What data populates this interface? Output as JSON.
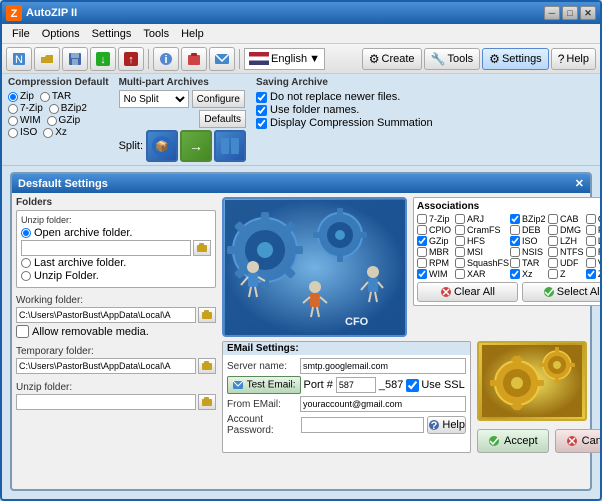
{
  "app": {
    "title": "AutoZIP II",
    "icon": "zip"
  },
  "titlebar": {
    "buttons": {
      "minimize": "─",
      "maximize": "□",
      "close": "✕"
    }
  },
  "menubar": {
    "items": [
      "File",
      "Options",
      "Settings",
      "Tools",
      "Help"
    ]
  },
  "toolbar": {
    "lang": "English",
    "right_buttons": [
      "Create",
      "Tools",
      "Settings",
      "Help"
    ]
  },
  "compression": {
    "title": "Compression Default",
    "options": [
      {
        "label": "Zip",
        "checked": true
      },
      {
        "label": "TAR",
        "checked": false
      },
      {
        "label": "7-Zip",
        "checked": false
      },
      {
        "label": "BZip2",
        "checked": false
      },
      {
        "label": "WIM",
        "checked": false
      },
      {
        "label": "GZip",
        "checked": false
      },
      {
        "label": "ISO",
        "checked": false
      },
      {
        "label": "Xz",
        "checked": false
      }
    ]
  },
  "multipart": {
    "title": "Multi-part Archives",
    "split_label": "Split:",
    "no_split_label": "No Split",
    "configure_label": "Configure",
    "defaults_label": "Defaults"
  },
  "saving": {
    "title": "Saving Archive",
    "options": [
      {
        "label": "Do not replace newer files.",
        "checked": true
      },
      {
        "label": "Use folder names.",
        "checked": true
      },
      {
        "label": "Display Compression Summation",
        "checked": true
      }
    ]
  },
  "panel": {
    "title": "Desfault Settings"
  },
  "folders": {
    "title": "Folders",
    "unzip_label": "Unzip folder:",
    "open_archive_label": "Open archive folder.",
    "last_archive_label": "Last archive folder.",
    "unzip_folder_label": "Unzip Folder.",
    "working_label": "Working folder:",
    "working_value": "C:\\Users\\PastorBust\\AppData\\Local\\A",
    "allow_removable": "Allow removable media.",
    "temp_label": "Temporary folder:",
    "temp_value": "C:\\Users\\PastorBust\\AppData\\Local\\A",
    "unzip_bottom_label": "Unzip folder:"
  },
  "associations": {
    "title": "Associations",
    "items": [
      {
        "label": "7-Zip",
        "checked": false
      },
      {
        "label": "ARJ",
        "checked": false
      },
      {
        "label": "BZip2",
        "checked": true
      },
      {
        "label": "CAB",
        "checked": false
      },
      {
        "label": "CHM",
        "checked": false
      },
      {
        "label": "CPIO",
        "checked": false
      },
      {
        "label": "CramFS",
        "checked": false
      },
      {
        "label": "DEB",
        "checked": false
      },
      {
        "label": "DMG",
        "checked": false
      },
      {
        "label": "FAT",
        "checked": false
      },
      {
        "label": "GZip",
        "checked": true
      },
      {
        "label": "HFS",
        "checked": false
      },
      {
        "label": "ISO",
        "checked": true
      },
      {
        "label": "LZH",
        "checked": false
      },
      {
        "label": "LZMA",
        "checked": false
      },
      {
        "label": "MBR",
        "checked": false
      },
      {
        "label": "MSI",
        "checked": false
      },
      {
        "label": "NSIS",
        "checked": false
      },
      {
        "label": "NTFS",
        "checked": false
      },
      {
        "label": "RAR",
        "checked": false
      },
      {
        "label": "RPM",
        "checked": false
      },
      {
        "label": "SquashFS",
        "checked": false
      },
      {
        "label": "TAR",
        "checked": false
      },
      {
        "label": "UDF",
        "checked": false
      },
      {
        "label": "VHD",
        "checked": false
      },
      {
        "label": "WIM",
        "checked": true
      },
      {
        "label": "XAR",
        "checked": false
      },
      {
        "label": "Xz",
        "checked": true
      },
      {
        "label": "Z",
        "checked": false
      },
      {
        "label": "ZIP",
        "checked": true
      }
    ],
    "clear_all": "Clear All",
    "select_all": "Select All"
  },
  "email": {
    "title": "EMail Settings:",
    "server_label": "Server name:",
    "server_value": "smtp.googlemail.com",
    "test_label": "Test Email:",
    "port_label": "Port #",
    "port_value": "587",
    "use_ssl_label": "Use SSL",
    "from_label": "From EMail:",
    "from_value": "youraccount@gmail.com",
    "password_label": "Account Password:",
    "help_label": "Help"
  },
  "buttons": {
    "accept": "Accept",
    "cancel": "Cancel"
  },
  "colors": {
    "accent": "#1a5fa8",
    "bg": "#d4e4f0",
    "gear_blue": "#4488cc",
    "gear_gold": "#c8a830"
  }
}
